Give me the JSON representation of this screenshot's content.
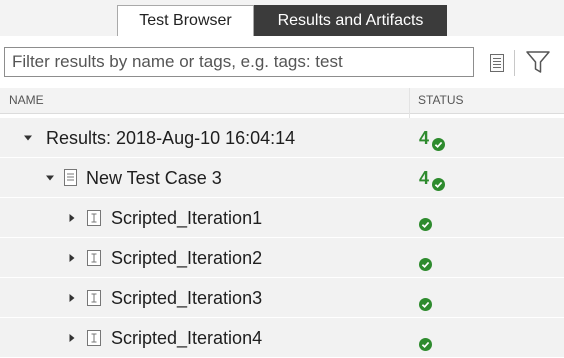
{
  "tabs": [
    {
      "label": "Test Browser",
      "active": false
    },
    {
      "label": "Results and Artifacts",
      "active": true
    }
  ],
  "filter": {
    "placeholder": "Filter results by name or tags, e.g. tags: test",
    "value": ""
  },
  "columns": {
    "name": "NAME",
    "status": "STATUS"
  },
  "tree": {
    "results": {
      "label": "Results: 2018-Aug-10 16:04:14",
      "passed_count": "4",
      "expanded": true
    },
    "test_case": {
      "label": "New Test Case 3",
      "passed_count": "4",
      "expanded": true
    },
    "iterations": [
      {
        "label": "Scripted_Iteration1",
        "status": "passed"
      },
      {
        "label": "Scripted_Iteration2",
        "status": "passed"
      },
      {
        "label": "Scripted_Iteration3",
        "status": "passed"
      },
      {
        "label": "Scripted_Iteration4",
        "status": "passed"
      }
    ]
  },
  "colors": {
    "pass_green": "#2e8b2e",
    "active_tab": "#3b3b3b"
  }
}
